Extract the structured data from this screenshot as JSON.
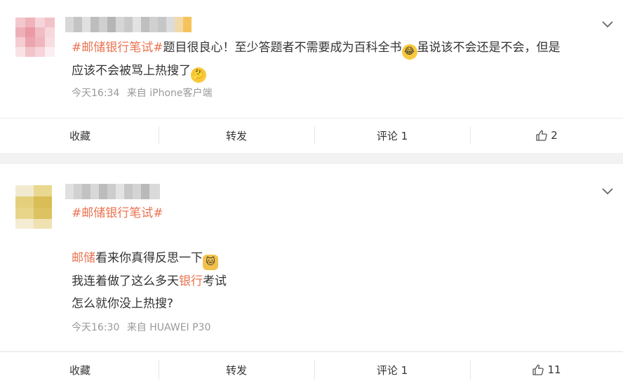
{
  "posts": [
    {
      "topic": "#邮储银行笔试#",
      "text_a": "题目很良心！至少答题者不需要成为百科全书",
      "emoji_a": "laughing-tears-emoji",
      "text_b": "虽说该不会还是不会，但是",
      "text_c": "应该不会被骂上热搜了",
      "emoji_b": "thinking-emoji",
      "time": "今天16:34",
      "source": "来自 iPhone客户端",
      "actions": {
        "fav": "收藏",
        "repost": "转发",
        "comment": "评论 1",
        "like": "2"
      }
    },
    {
      "topic": "#邮储银行笔试#",
      "line1_hl": "邮储",
      "line1_rest": "看来你真得反思一下",
      "emoji_a": "cat-face-emoji",
      "line2_a": "我连着做了这么多天",
      "line2_hl": "银行",
      "line2_b": "考试",
      "line3": "怎么就你没上热搜?",
      "time": "今天16:30",
      "source": "来自 HUAWEI P30",
      "actions": {
        "fav": "收藏",
        "repost": "转发",
        "comment": "评论 1",
        "like": "11"
      }
    }
  ]
}
